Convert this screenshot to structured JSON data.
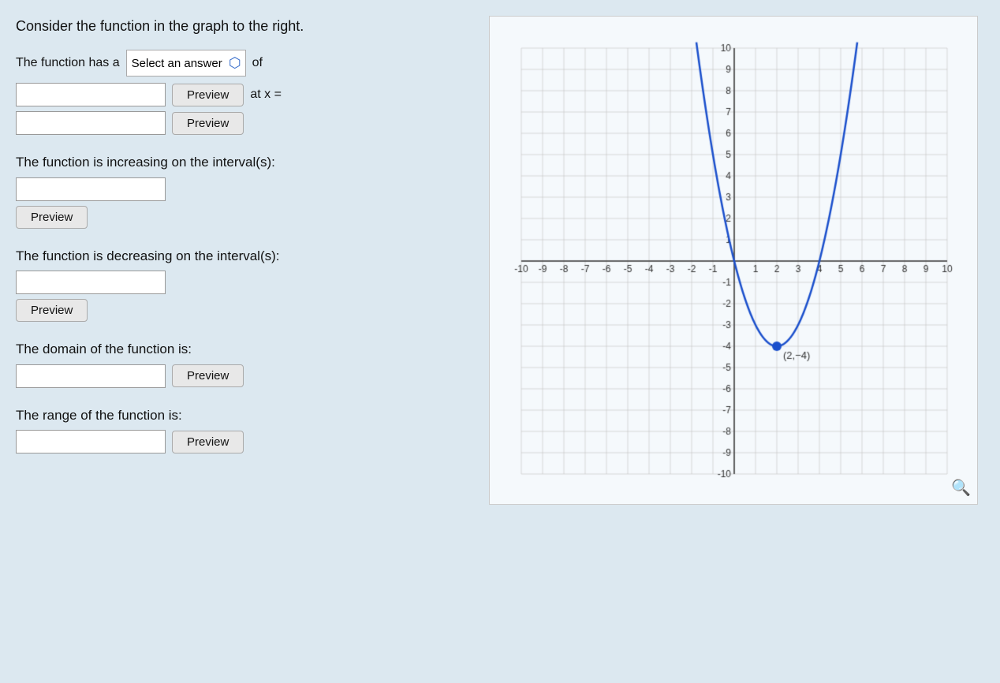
{
  "question": {
    "intro": "Consider the function in the graph to the right.",
    "line1": "The function has a",
    "select_placeholder": "Select an answer",
    "of_text": "of",
    "at_x_text": "at x =",
    "increasing_label": "The function is increasing on the interval(s):",
    "decreasing_label": "The function is decreasing on the interval(s):",
    "domain_label": "The domain of the function is:",
    "range_label": "The range of the function is:"
  },
  "buttons": {
    "preview": "Preview"
  },
  "graph": {
    "point_label": "(2,−4)",
    "x_min": -10,
    "x_max": 10,
    "y_min": -10,
    "y_max": 10
  },
  "icons": {
    "zoom": "🔍",
    "chevron": "⌃"
  }
}
